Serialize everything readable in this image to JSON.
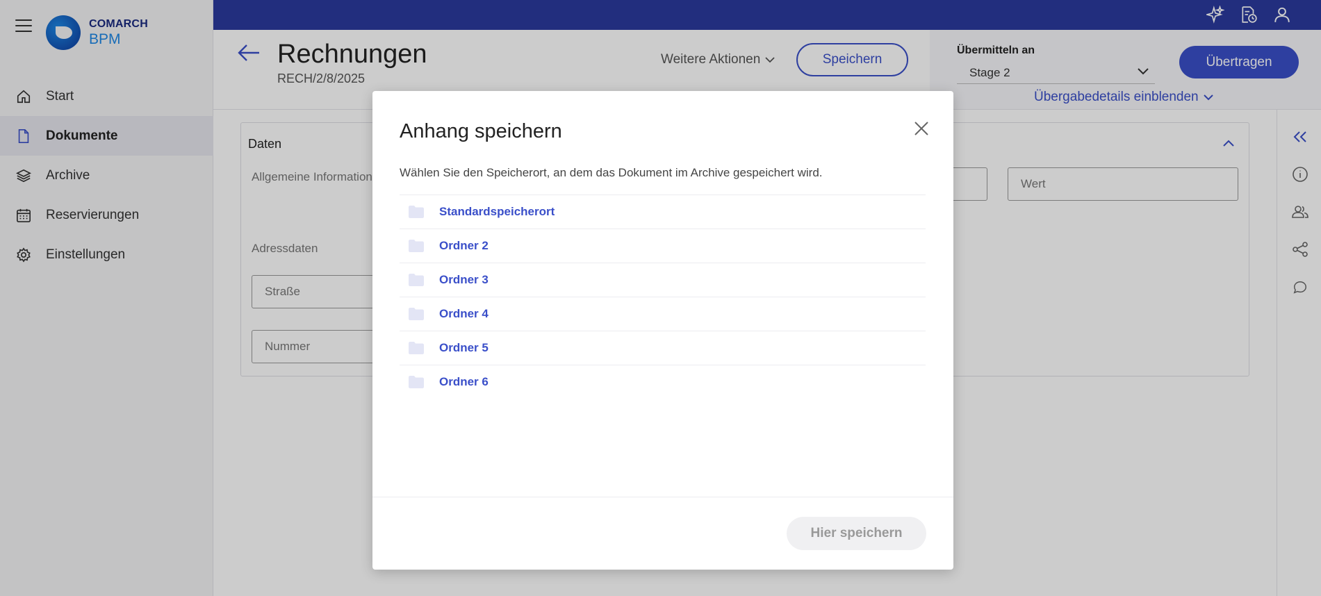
{
  "app": {
    "logo_line1": "COMARCH",
    "logo_line2": "BPM"
  },
  "sidebar": {
    "items": [
      {
        "label": "Start",
        "icon": "home-icon"
      },
      {
        "label": "Dokumente",
        "icon": "document-icon",
        "active": true
      },
      {
        "label": "Archive",
        "icon": "layers-icon"
      },
      {
        "label": "Reservierungen",
        "icon": "calendar-icon"
      },
      {
        "label": "Einstellungen",
        "icon": "gear-icon"
      }
    ]
  },
  "topbar": {
    "icons": [
      "sparkle-icon",
      "document-clock-icon",
      "user-icon"
    ]
  },
  "header": {
    "title": "Rechnungen",
    "subtitle": "RECH/2/8/2025",
    "more_actions": "Weitere Aktionen",
    "save_label": "Speichern"
  },
  "transfer": {
    "label": "Übermitteln an",
    "selected": "Stage 2",
    "button_label": "Übertragen",
    "details_link": "Übergabedetails einblenden"
  },
  "form": {
    "card_title": "Daten",
    "section_general": "Allgemeine Information",
    "section_address": "Adressdaten",
    "street_placeholder": "Straße",
    "number_placeholder": "Nummer",
    "value_placeholder": "Wert"
  },
  "rail": {
    "icons": [
      "collapse-left-icon",
      "info-icon",
      "people-icon",
      "share-icon",
      "comment-icon"
    ]
  },
  "dialog": {
    "title": "Anhang speichern",
    "description": "Wählen Sie den Speicherort, an dem das Dokument im Archive gespeichert wird.",
    "folders": [
      "Standardspeicherort",
      "Ordner 2",
      "Ordner 3",
      "Ordner 4",
      "Ordner 5",
      "Ordner 6"
    ],
    "save_here": "Hier speichern"
  },
  "colors": {
    "accent": "#3a4fc9",
    "topbar": "#2b3a9e",
    "folder": "#e3e5f5"
  }
}
